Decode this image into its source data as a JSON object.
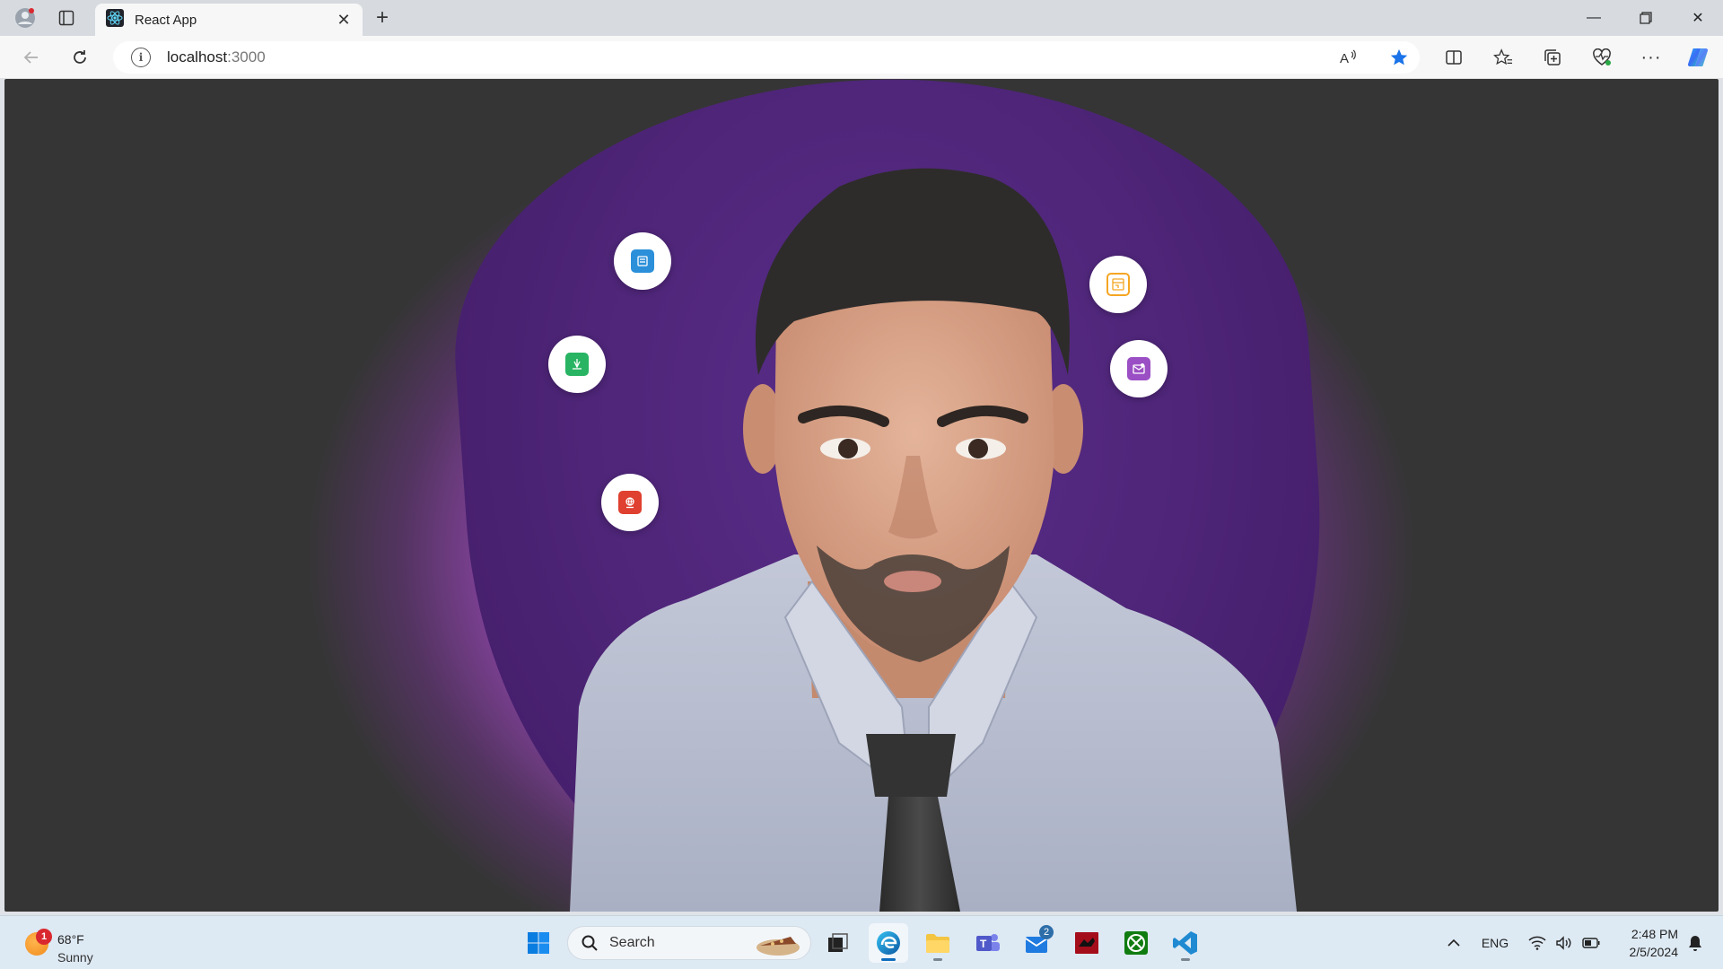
{
  "browser": {
    "tab": {
      "title": "React App"
    },
    "address": {
      "host": "localhost",
      "port": ":3000"
    }
  },
  "viewport": {
    "background": "#353535",
    "accent_glow": "#a050be",
    "blob_color": "#4e2578",
    "floating_icons": [
      {
        "name": "book-icon",
        "color": "#2b8fd9"
      },
      {
        "name": "pencil-book-icon",
        "color": "#28b463"
      },
      {
        "name": "globe-book-icon",
        "color": "#e0402f"
      },
      {
        "name": "slides-icon",
        "color": "#f5a623"
      },
      {
        "name": "mail-icon",
        "color": "#9b4fc4"
      }
    ]
  },
  "taskbar": {
    "weather": {
      "badge": "1",
      "temp": "68°F",
      "condition": "Sunny"
    },
    "search_placeholder": "Search",
    "mail_badge": "2",
    "tray": {
      "language": "ENG"
    },
    "clock": {
      "time": "2:48 PM",
      "date": "2/5/2024"
    }
  }
}
